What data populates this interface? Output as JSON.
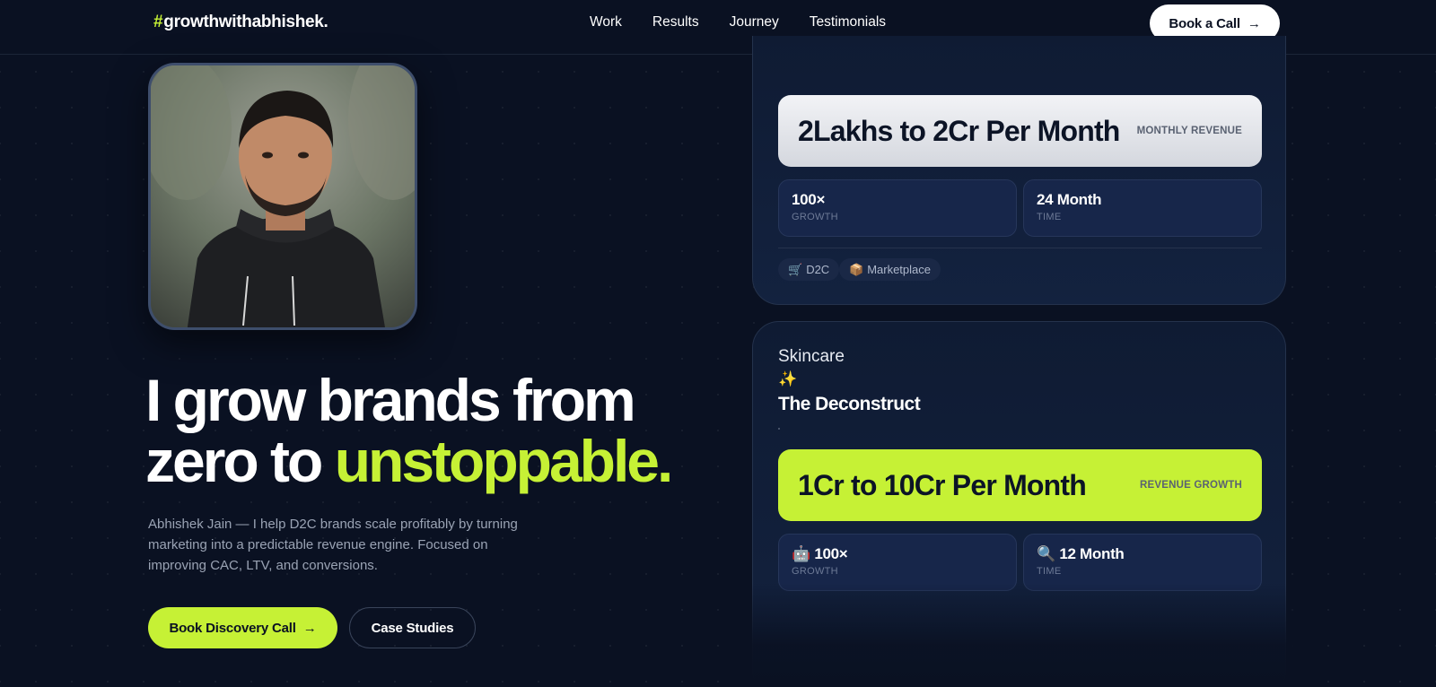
{
  "nav": {
    "logo_hash": "#",
    "logo_text": "growthwithabhishek.",
    "links": [
      "Work",
      "Results",
      "Journey",
      "Testimonials"
    ],
    "cta_label": "Book a Call",
    "cta_arrow": "→"
  },
  "hero": {
    "headline_line1": "I grow brands from",
    "headline_line2_pre": "zero to ",
    "headline_accent": "unstoppable",
    "headline_period": ".",
    "subtext": "Abhishek Jain — I help D2C brands scale profitably by turning marketing into a predictable revenue engine. Focused on improving CAC, LTV, and conversions.",
    "primary_button": "Book Discovery Call",
    "primary_arrow": "→",
    "secondary_button": "Case Studies",
    "photo_icon": "person-portrait"
  },
  "cases": [
    {
      "revenue_value": "2Lakhs to 2Cr Per Month",
      "revenue_label": "MONTHLY REVENUE",
      "stats": [
        {
          "icon": "",
          "value": "100×",
          "label": "GROWTH"
        },
        {
          "icon": "",
          "value": "24 Month",
          "label": "TIME"
        }
      ],
      "tags": [
        {
          "icon": "🛒",
          "label": "D2C"
        },
        {
          "icon": "📦",
          "label": "Marketplace"
        }
      ]
    },
    {
      "category": "Skincare",
      "category_icon": "✨",
      "brand": "The Deconstruct",
      "revenue_value": "1Cr to 10Cr Per Month",
      "revenue_label": "REVENUE GROWTH",
      "stats": [
        {
          "icon": "🤖",
          "value": "100×",
          "label": "GROWTH"
        },
        {
          "icon": "🔍",
          "value": "12 Month",
          "label": "TIME"
        }
      ]
    }
  ],
  "colors": {
    "background": "#0a1122",
    "accent": "#c6f135",
    "card": "#13223f"
  }
}
